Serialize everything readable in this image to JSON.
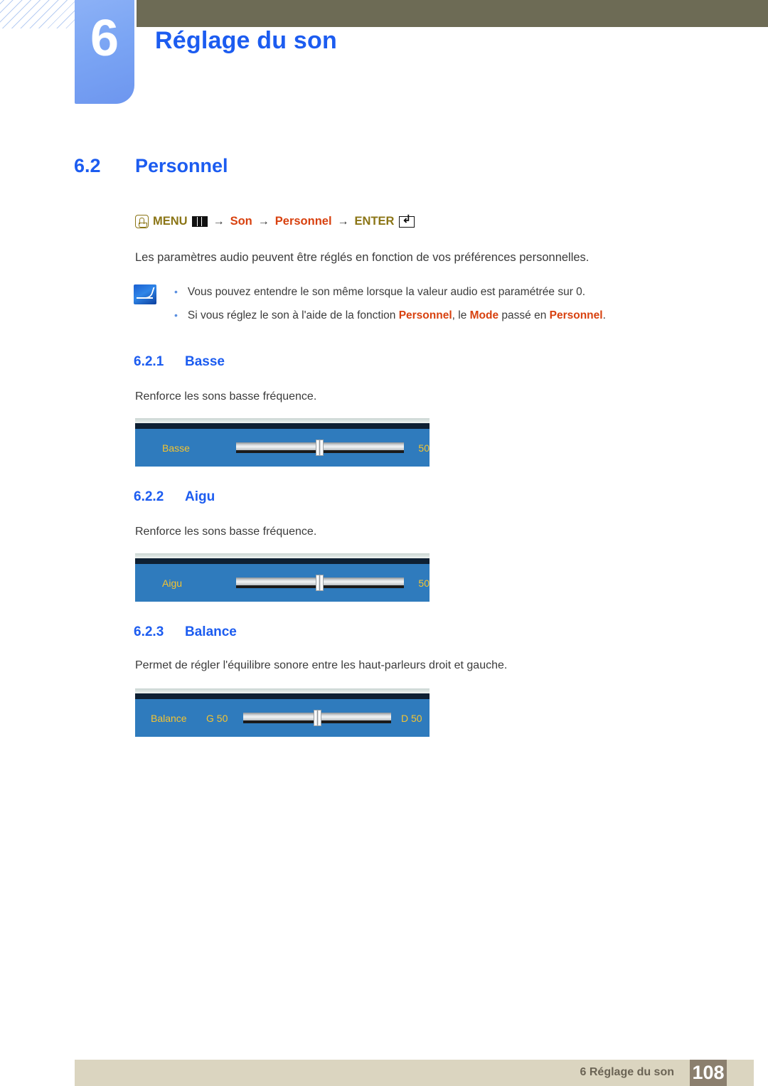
{
  "header": {
    "chapter_number": "6",
    "chapter_title": "Réglage du son"
  },
  "section": {
    "number": "6.2",
    "title": "Personnel"
  },
  "menu_path": {
    "hand_icon": "hand-press-icon",
    "menu_label": "MENU",
    "menu_icon": "menu-grid-icon",
    "arrow1": "→",
    "item1": "Son",
    "arrow2": "→",
    "item2": "Personnel",
    "arrow3": "→",
    "enter_label": "ENTER",
    "enter_icon": "enter-key-icon"
  },
  "intro": "Les paramètres audio peuvent être réglés en fonction de vos préférences personnelles.",
  "notes": {
    "icon": "note-pencil-icon",
    "items": [
      {
        "bullet": "•",
        "parts": [
          {
            "text": "Vous pouvez entendre le son même lorsque la valeur audio est paramétrée sur 0.",
            "highlight": false
          }
        ]
      },
      {
        "bullet": "•",
        "parts": [
          {
            "text": "Si vous réglez le son à l'aide de la fonction ",
            "highlight": false
          },
          {
            "text": "Personnel",
            "highlight": true
          },
          {
            "text": ", le ",
            "highlight": false
          },
          {
            "text": "Mode",
            "highlight": true
          },
          {
            "text": " passé en ",
            "highlight": false
          },
          {
            "text": "Personnel",
            "highlight": true
          },
          {
            "text": ".",
            "highlight": false
          }
        ]
      }
    ]
  },
  "subsections": [
    {
      "number": "6.2.1",
      "title": "Basse",
      "description": "Renforce les sons basse fréquence.",
      "osd": {
        "type": "single",
        "label": "Basse",
        "value": "50",
        "thumb_percent": 50
      }
    },
    {
      "number": "6.2.2",
      "title": "Aigu",
      "description": "Renforce les sons basse fréquence.",
      "osd": {
        "type": "single",
        "label": "Aigu",
        "value": "50",
        "thumb_percent": 50
      }
    },
    {
      "number": "6.2.3",
      "title": "Balance",
      "description": "Permet de régler l'équilibre sonore entre les haut-parleurs droit et gauche.",
      "osd": {
        "type": "balance",
        "label": "Balance",
        "left_value": "G 50",
        "right_value": "D 50",
        "thumb_percent": 50
      }
    }
  ],
  "footer": {
    "text": "6 Réglage du son",
    "page": "108"
  },
  "colors": {
    "accent_blue": "#1c5cf0",
    "olive": "#6d6b55",
    "gold": "#8b7516",
    "red": "#d8410f",
    "osd_blue": "#2f7bbd",
    "osd_gold": "#f5c430",
    "footer_beige": "#dbd5c0",
    "footer_page_brown": "#8b7f6e"
  }
}
